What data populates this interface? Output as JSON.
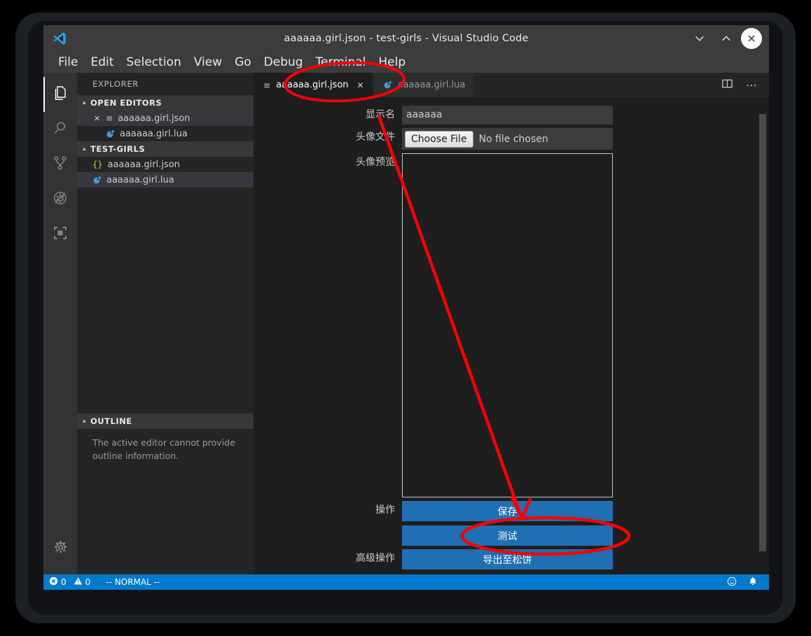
{
  "window": {
    "title": "aaaaaa.girl.json - test-girls - Visual Studio Code",
    "logo_icon": "vscode-logo-icon",
    "minimize_label": "∨",
    "maximize_label": "∧",
    "close_label": "✕"
  },
  "menubar": {
    "items": [
      {
        "label": "File"
      },
      {
        "label": "Edit"
      },
      {
        "label": "Selection"
      },
      {
        "label": "View"
      },
      {
        "label": "Go"
      },
      {
        "label": "Debug"
      },
      {
        "label": "Terminal"
      },
      {
        "label": "Help"
      }
    ]
  },
  "activitybar": {
    "items": [
      {
        "name": "explorer",
        "icon": "files-icon",
        "active": true
      },
      {
        "name": "search",
        "icon": "search-icon",
        "active": false
      },
      {
        "name": "source-control",
        "icon": "source-control-icon",
        "active": false
      },
      {
        "name": "debug",
        "icon": "debug-icon",
        "active": false
      },
      {
        "name": "extensions",
        "icon": "extensions-icon",
        "active": false
      }
    ],
    "settings_icon": "gear-icon"
  },
  "sidebar": {
    "title": "EXPLORER",
    "open_editors": {
      "header": "OPEN EDITORS",
      "twisty": "▴",
      "items": [
        {
          "label": "aaaaaa.girl.json",
          "icon": "json-lines-icon",
          "dirty_close": "✕",
          "selected": true
        },
        {
          "label": "aaaaaa.girl.lua",
          "icon": "lua-icon",
          "dirty_close": "",
          "selected": false
        }
      ]
    },
    "folder": {
      "header": "TEST-GIRLS",
      "twisty": "▴",
      "items": [
        {
          "label": "aaaaaa.girl.json",
          "icon": "json-braces-icon",
          "selected": false
        },
        {
          "label": "aaaaaa.girl.lua",
          "icon": "lua-icon",
          "selected": true
        }
      ]
    },
    "outline": {
      "header": "OUTLINE",
      "twisty": "▴",
      "message": "The active editor cannot provide outline information."
    }
  },
  "tabs": {
    "items": [
      {
        "label": "aaaaaa.girl.json",
        "icon": "json-lines-icon",
        "active": true,
        "close": "✕"
      },
      {
        "label": "aaaaaa.girl.lua",
        "icon": "lua-icon",
        "active": false,
        "close": ""
      }
    ],
    "actions": [
      {
        "name": "split-editor-icon"
      },
      {
        "name": "more-actions-icon",
        "label": "⋯"
      }
    ]
  },
  "form": {
    "rows": [
      {
        "label": "显示名",
        "type": "text",
        "value": "aaaaaa",
        "placeholder": ""
      },
      {
        "label": "头像文件",
        "type": "file",
        "button": "Choose File",
        "status": "No file chosen"
      },
      {
        "label": "头像预览",
        "type": "preview"
      },
      {
        "label": "操作",
        "type": "buttons",
        "buttons": [
          "保存",
          "测试"
        ]
      },
      {
        "label": "高级操作",
        "type": "buttons",
        "buttons": [
          "导出至松饼"
        ]
      }
    ]
  },
  "statusbar": {
    "errors_icon": "error-icon",
    "errors": "0",
    "warnings_icon": "warning-icon",
    "warnings": "0",
    "mode": "-- NORMAL --",
    "feedback_icon": "smiley-icon",
    "bell_icon": "bell-icon"
  },
  "annotations": {
    "accent_color": "#f80000",
    "items": [
      {
        "name": "ellipse-active-tab",
        "shape": "ellipse"
      },
      {
        "name": "arrow-to-save-button",
        "shape": "arrow"
      },
      {
        "name": "ellipse-test-button",
        "shape": "ellipse"
      }
    ]
  },
  "colors": {
    "titlebar": "#3c3c3c",
    "activitybar": "#333333",
    "sidebar": "#252526",
    "editor": "#1e1e1e",
    "statusbar": "#007acc",
    "button_blue": "#1f6fb2",
    "annotation_red": "#f80000"
  }
}
